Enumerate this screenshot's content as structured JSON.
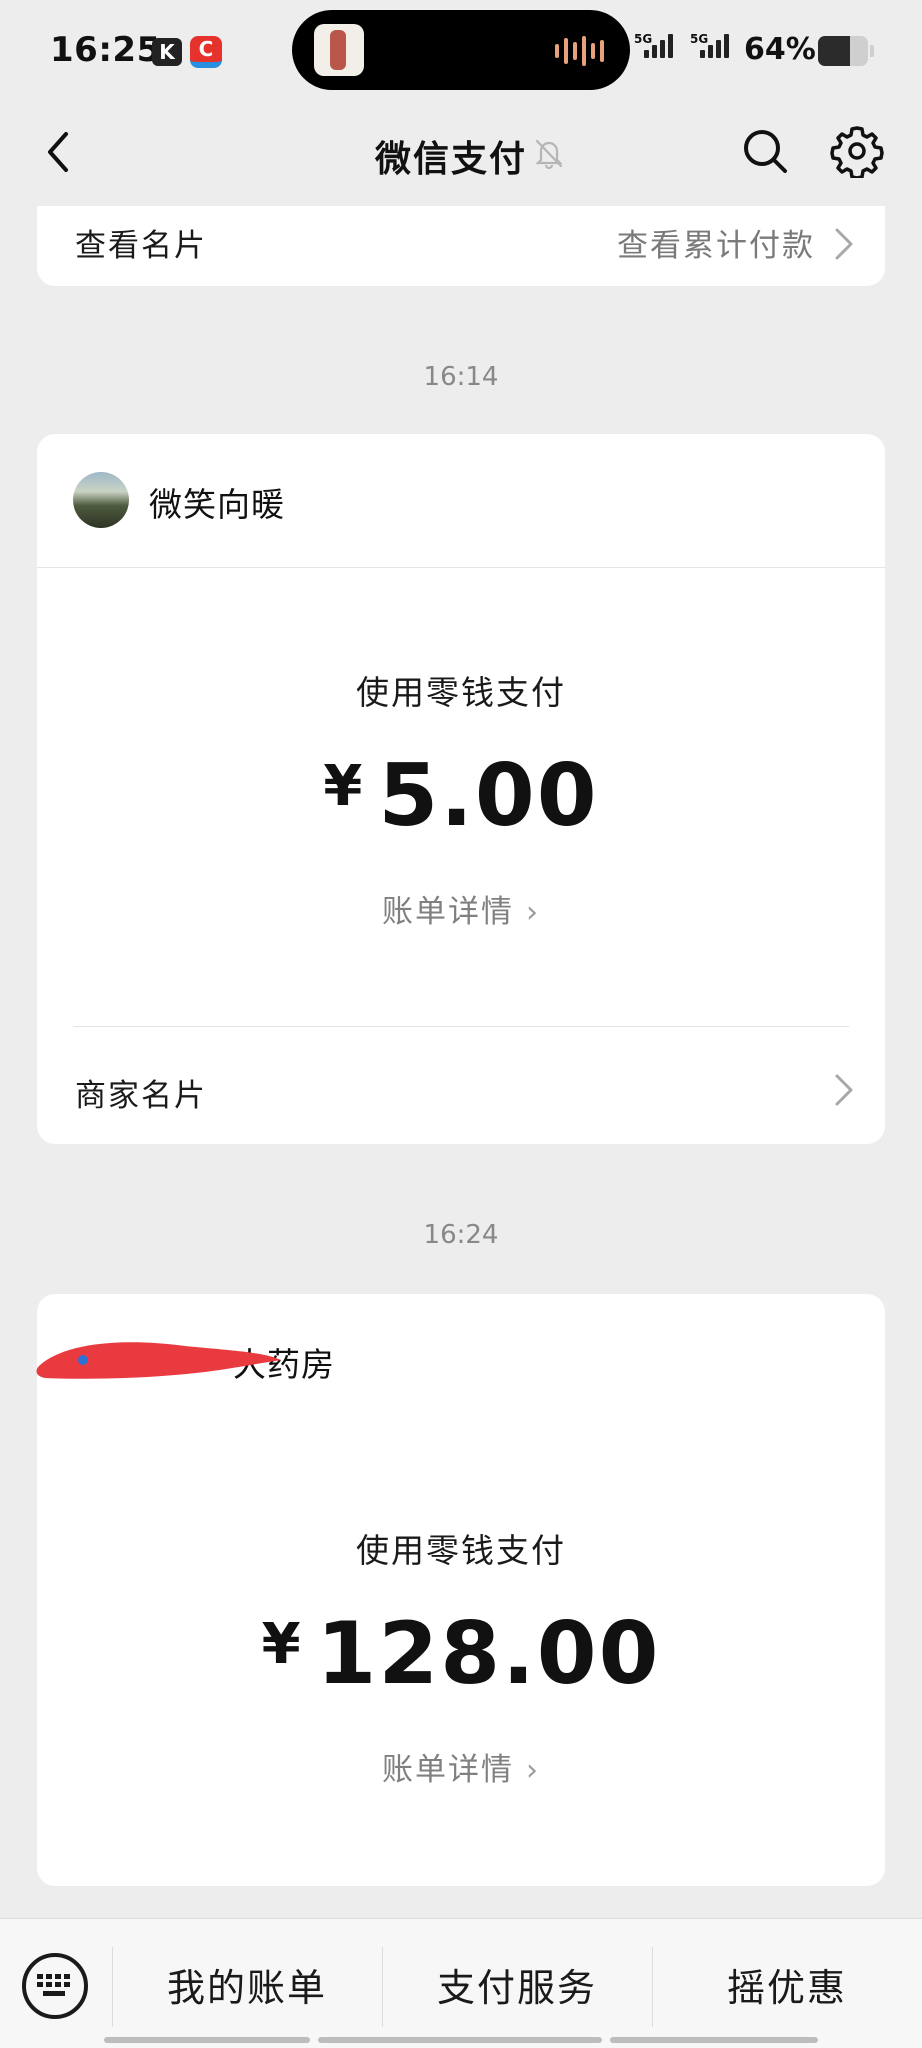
{
  "status_bar": {
    "time": "16:25",
    "app_k": "K",
    "app_c": "C",
    "network_1": "5G",
    "network_2": "5G",
    "battery_pct": "64%",
    "battery_level": 0.64
  },
  "nav": {
    "title": "微信支付",
    "back_icon": "chevron-left-icon",
    "mute_icon": "bell-off-icon",
    "search_icon": "search-icon",
    "settings_icon": "gear-icon"
  },
  "top_card": {
    "left_label": "查看名片",
    "right_label": "查看累计付款"
  },
  "messages": [
    {
      "time": "16:14",
      "merchant": "微笑向暖",
      "method": "使用零钱支付",
      "currency": "¥",
      "amount": "5.00",
      "detail_link": "账单详情",
      "footer_label": "商家名片"
    },
    {
      "time": "16:24",
      "merchant": "大药房",
      "method": "使用零钱支付",
      "currency": "¥",
      "amount": "128.00",
      "detail_link": "账单详情"
    }
  ],
  "bottom_bar": {
    "keyboard_icon": "keyboard-icon",
    "items": [
      "我的账单",
      "支付服务",
      "摇优惠"
    ]
  },
  "colors": {
    "background": "#ededed",
    "card": "#ffffff",
    "redaction": "#e83a3f"
  }
}
